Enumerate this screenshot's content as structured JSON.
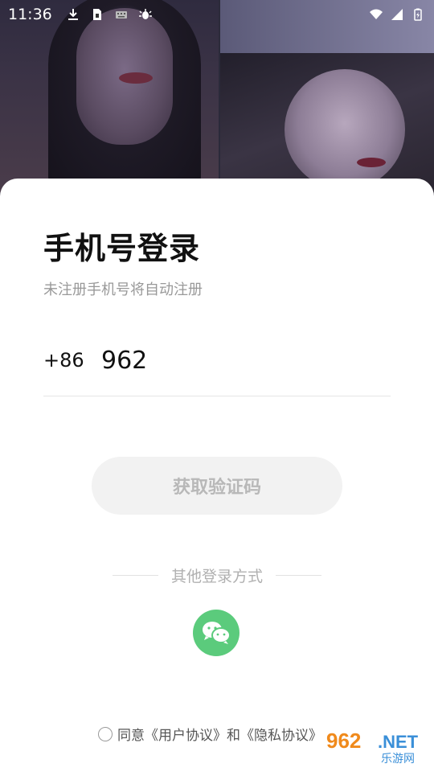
{
  "status_bar": {
    "time": "11:36"
  },
  "login": {
    "title": "手机号登录",
    "subtitle": "未注册手机号将自动注册",
    "country_code": "+86",
    "phone_value": "962",
    "get_code_label": "获取验证码",
    "other_methods_label": "其他登录方式",
    "agreement_prefix": "同意",
    "user_agreement": "《用户协议》",
    "and": "和",
    "privacy_policy": "《隐私协议》"
  },
  "watermark": {
    "number": "962",
    "suffix": ".NET",
    "site": "乐游网"
  },
  "colors": {
    "wechat_green": "#5bcb7c",
    "button_bg": "#f2f2f2",
    "button_text": "#b8b8b8"
  },
  "icons": [
    "download-icon",
    "sim-icon",
    "keyboard-icon",
    "bug-icon",
    "wifi-icon",
    "signal-icon",
    "battery-icon",
    "wechat-icon"
  ]
}
